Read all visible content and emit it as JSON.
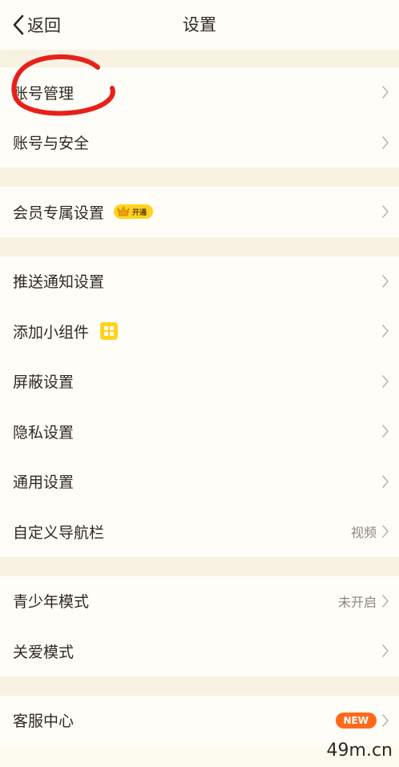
{
  "header": {
    "back_label": "返回",
    "title": "设置"
  },
  "groups": [
    {
      "items": [
        {
          "label": "账号管理"
        },
        {
          "label": "账号与安全"
        }
      ]
    },
    {
      "items": [
        {
          "label": "会员专属设置",
          "badge": "开通"
        }
      ]
    },
    {
      "items": [
        {
          "label": "推送通知设置"
        },
        {
          "label": "添加小组件"
        },
        {
          "label": "屏蔽设置"
        },
        {
          "label": "隐私设置"
        },
        {
          "label": "通用设置"
        },
        {
          "label": "自定义导航栏",
          "value": "视频"
        }
      ]
    },
    {
      "items": [
        {
          "label": "青少年模式",
          "value": "未开启"
        },
        {
          "label": "关爱模式"
        }
      ]
    },
    {
      "items": [
        {
          "label": "客服中心",
          "badge": "NEW"
        }
      ]
    }
  ],
  "watermark": "49m.cn",
  "colors": {
    "accent_yellow": "#ffd21f",
    "new_badge": "#ff6a1a",
    "annotation_red": "#e8201a",
    "background": "#fffdf7",
    "separator": "#f7f2e2"
  }
}
